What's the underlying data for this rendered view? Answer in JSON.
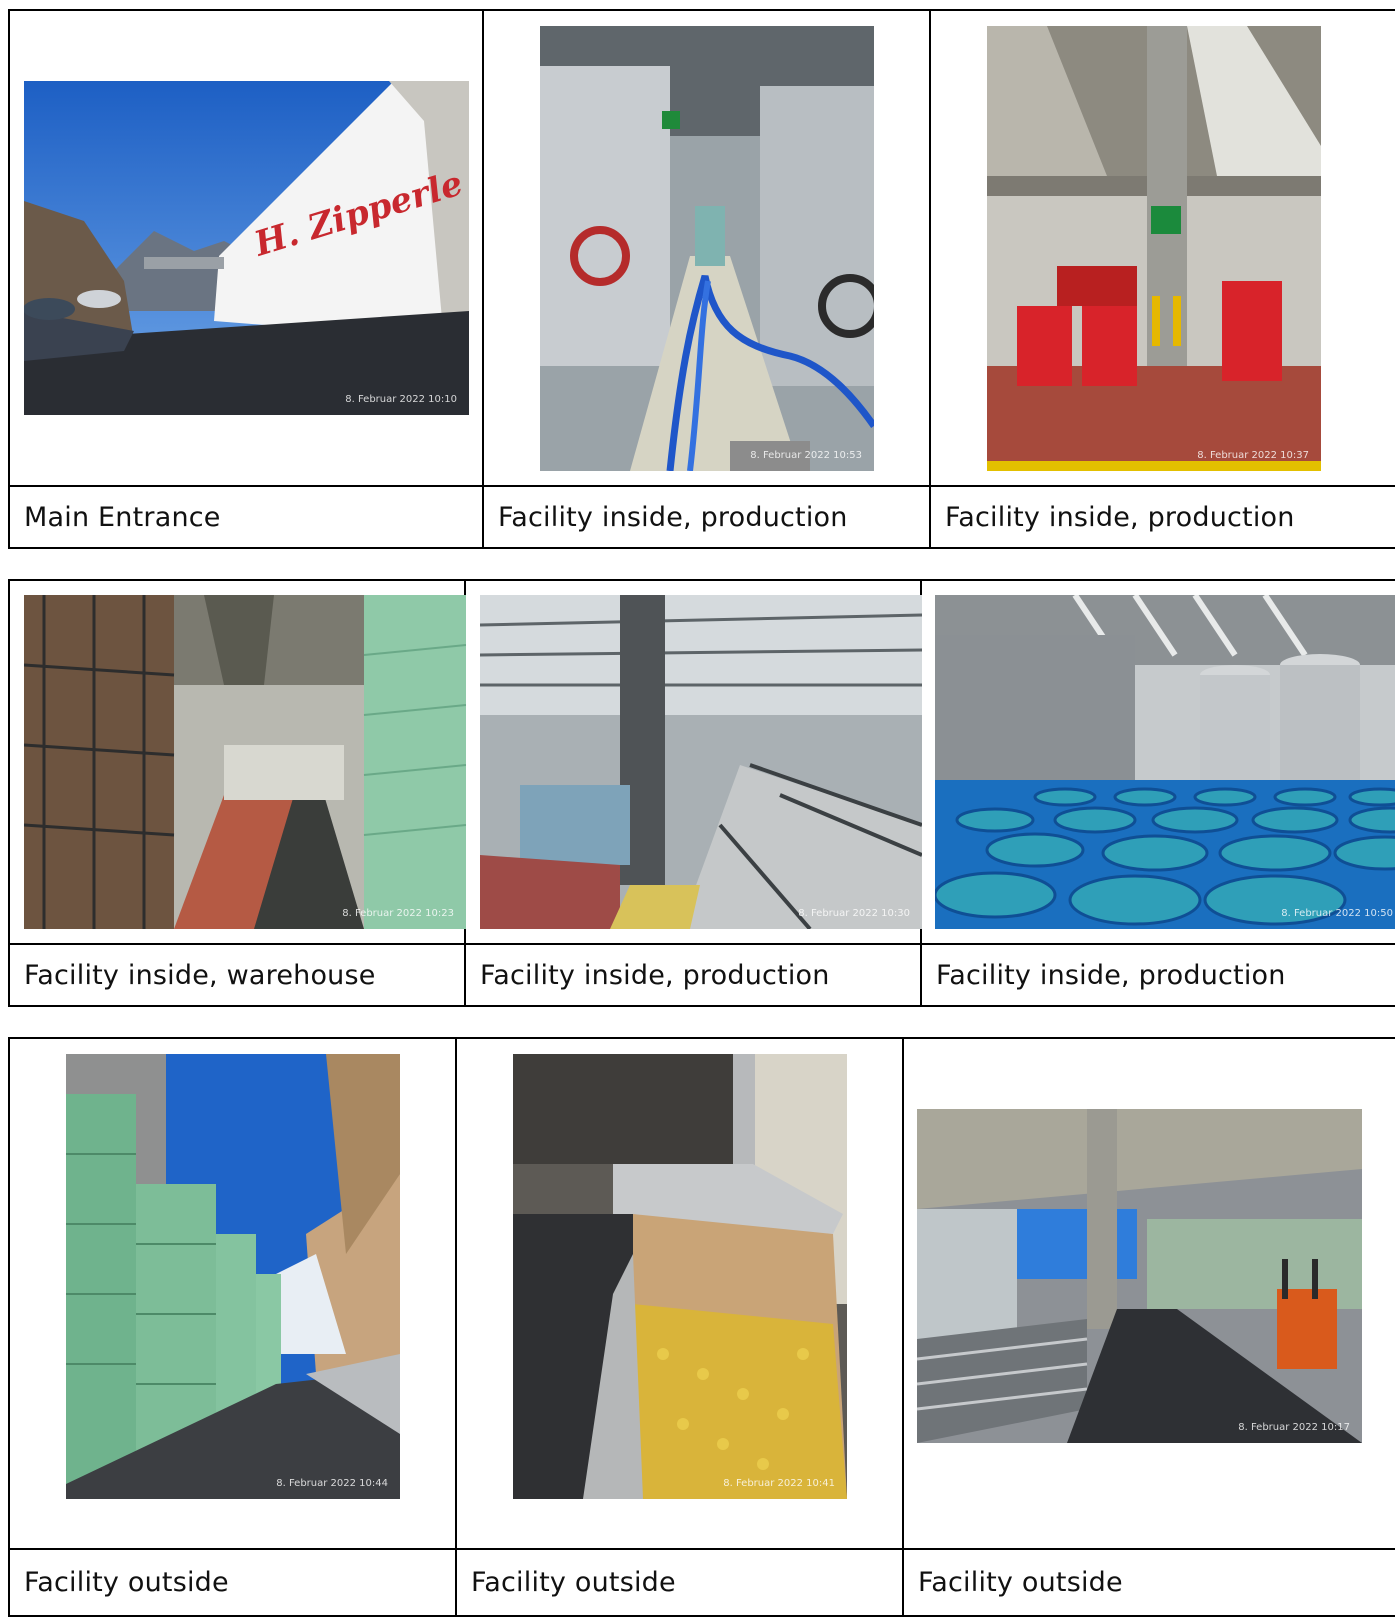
{
  "rows": [
    {
      "cells": [
        {
          "caption": "Main Entrance",
          "stamp": "8. Februar 2022 10:10",
          "sign": "H. Zipperle",
          "icon": "building-photo"
        },
        {
          "caption": "Facility inside, production",
          "stamp": "8. Februar 2022 10:53",
          "icon": "tank-corridor-photo"
        },
        {
          "caption": "Facility inside, production",
          "stamp": "8. Februar 2022 10:37",
          "icon": "hall-forklift-photo"
        }
      ]
    },
    {
      "cells": [
        {
          "caption": "Facility inside, warehouse",
          "stamp": "8. Februar 2022 10:23",
          "icon": "warehouse-racks-photo"
        },
        {
          "caption": "Facility inside, production",
          "stamp": "8. Februar 2022 10:30",
          "icon": "production-line-photo"
        },
        {
          "caption": "Facility inside, production",
          "stamp": "8. Februar 2022 10:50",
          "icon": "blue-bins-photo"
        }
      ]
    },
    {
      "cells": [
        {
          "caption": "Facility outside",
          "stamp": "8. Februar 2022 10:44",
          "icon": "crate-stacks-photo"
        },
        {
          "caption": "Facility outside",
          "stamp": "8. Februar 2022 10:41",
          "icon": "fruit-hopper-photo"
        },
        {
          "caption": "Facility outside",
          "stamp": "8. Februar 2022 10:17",
          "icon": "loading-dock-photo"
        }
      ]
    }
  ]
}
